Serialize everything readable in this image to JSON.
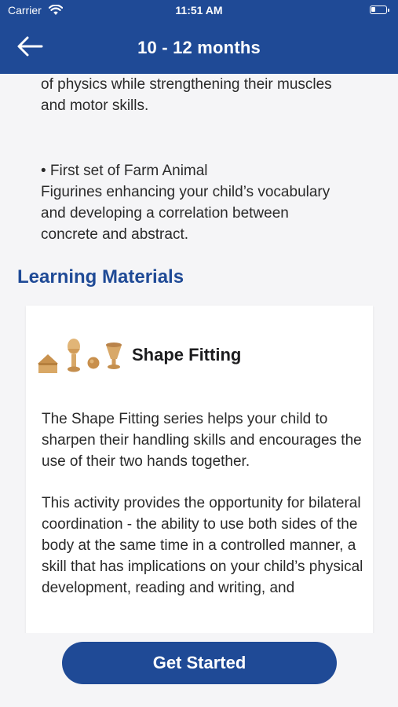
{
  "status_bar": {
    "carrier": "Carrier",
    "time": "11:51 AM"
  },
  "nav": {
    "title": "10 - 12 months",
    "back_icon": "arrow-left-icon"
  },
  "content": {
    "paragraph_1_lines": [
      "of physics while strengthening their muscles",
      "and motor skills."
    ],
    "bullet_line": "• First set of Farm Animal",
    "paragraph_2_lines": [
      "Figurines enhancing your child’s vocabulary",
      "and developing a correlation between",
      "concrete and abstract."
    ],
    "section_title": "Learning Materials"
  },
  "card": {
    "title": "Shape Fitting",
    "image_icon": "wooden-shapes-icon",
    "body_1": "The Shape Fitting series helps your child to sharpen their handling skills and encourages the use of their two hands together.",
    "body_2": "This activity provides the opportunity for bilateral coordination - the ability to use both sides of the body at the same time in a controlled manner, a skill that has implications on your child’s physical development, reading and writing, and"
  },
  "cta": {
    "label": "Get Started"
  },
  "colors": {
    "primary": "#1f4a96",
    "background": "#f5f5f7",
    "card": "#ffffff"
  }
}
